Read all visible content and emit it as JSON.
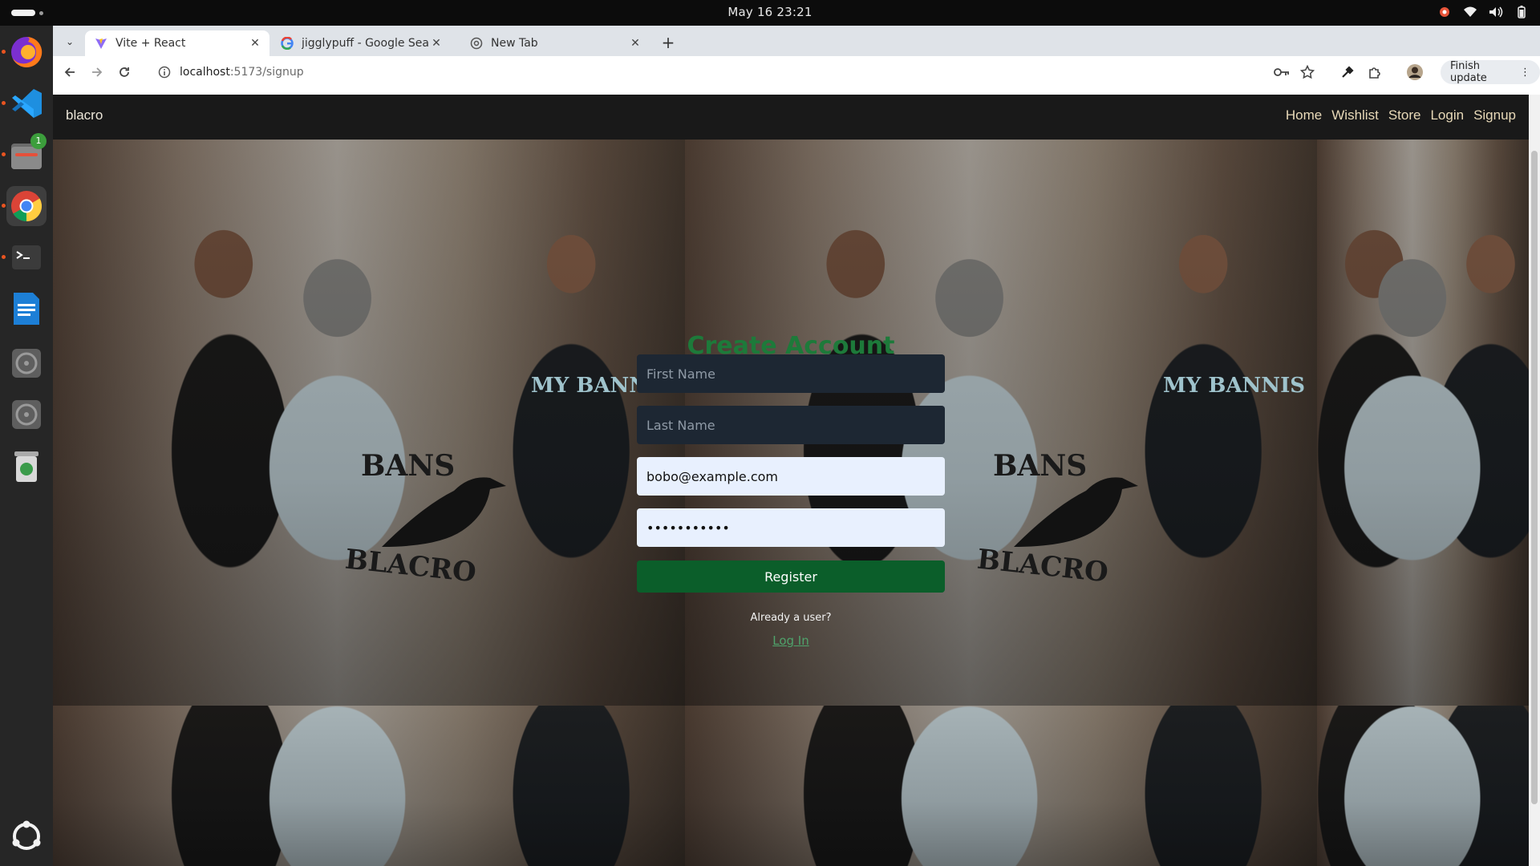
{
  "system": {
    "clock": "May 16  23:21",
    "tray_icons": [
      "record-indicator-icon",
      "wifi-icon",
      "volume-icon",
      "battery-icon"
    ]
  },
  "dock": {
    "items": [
      "firefox-icon",
      "vscode-icon",
      "files-icon",
      "chrome-icon",
      "terminal-icon",
      "text-editor-icon",
      "disc-icon",
      "disc-icon",
      "trash-icon",
      "apps-grid-icon"
    ],
    "files_badge": "1"
  },
  "browser": {
    "tabs": [
      {
        "title": "Vite + React",
        "active": true
      },
      {
        "title": "jigglypuff - Google Searc",
        "active": false
      },
      {
        "title": "New Tab",
        "active": false
      }
    ],
    "url_host": "localhost",
    "url_path": ":5173/signup",
    "finish_update": "Finish update"
  },
  "site": {
    "brand": "blacro",
    "nav": [
      "Home",
      "Wishlist",
      "Store",
      "Login",
      "Signup"
    ]
  },
  "hero_shirts": {
    "bans": "BANS",
    "blacro": "BLACRO",
    "my_bannis": "MY BANNIS"
  },
  "signup": {
    "title": "Create Account",
    "first_name_placeholder": "First Name",
    "last_name_placeholder": "Last Name",
    "email_value": "bobo@example.com",
    "password_value": "•••••••••••",
    "register_label": "Register",
    "already_text": "Already a user?",
    "login_link": "Log In"
  },
  "colors": {
    "accent_green": "#0b5e2a",
    "title_green": "#1d7a3a",
    "link_green": "#4fa36b",
    "nav_text": "#e8d9b8"
  }
}
